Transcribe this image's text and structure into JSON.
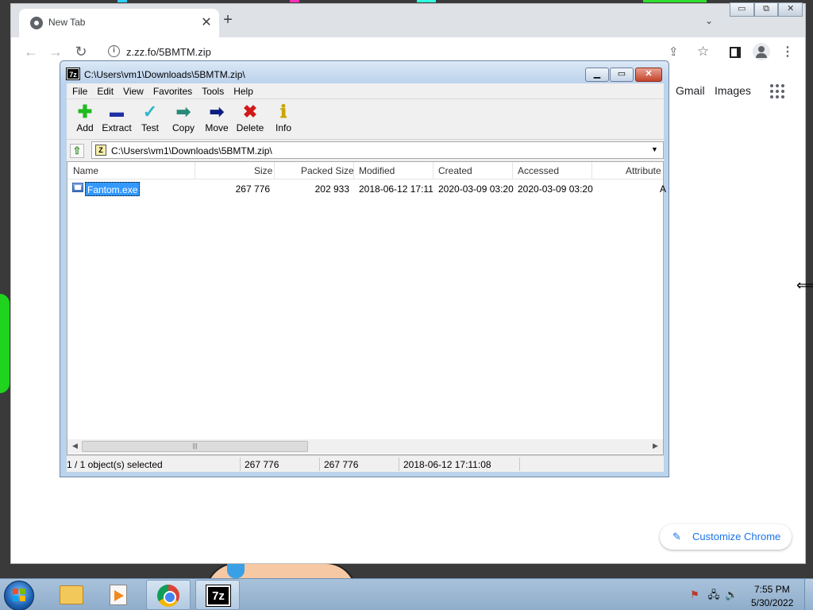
{
  "chrome": {
    "tab_title": "New Tab",
    "tab_close_glyph": "✕",
    "new_tab_glyph": "+",
    "tab_search_glyph": "⌄",
    "url": "z.zz.fo/5BMTM.zip",
    "ntp_links": [
      "Gmail",
      "Images"
    ],
    "customize_label": "Customize Chrome",
    "icons": {
      "back": "←",
      "forward": "→",
      "reload": "↻",
      "info": "i",
      "share": "⇪",
      "star": "☆",
      "menu": "⋮",
      "pencil": "✎"
    }
  },
  "outer_window_buttons": {
    "minimize": "▭",
    "restore": "⧉",
    "close": "✕"
  },
  "sevenzip": {
    "title": "C:\\Users\\vm1\\Downloads\\5BMTM.zip\\",
    "logo": "7z",
    "controls": {
      "minimize": "▁",
      "maximize": "▭",
      "close": "✕"
    },
    "menu": [
      "File",
      "Edit",
      "View",
      "Favorites",
      "Tools",
      "Help"
    ],
    "toolbar": [
      {
        "label": "Add",
        "glyph": "✚",
        "color": "#1dbb1d"
      },
      {
        "label": "Extract",
        "glyph": "▬",
        "color": "#1f2fa3"
      },
      {
        "label": "Test",
        "glyph": "✓",
        "color": "#2cb7c9"
      },
      {
        "label": "Copy",
        "glyph": "➡",
        "color": "#2a8a7a"
      },
      {
        "label": "Move",
        "glyph": "➡",
        "color": "#0b1f80"
      },
      {
        "label": "Delete",
        "glyph": "✖",
        "color": "#d11919"
      },
      {
        "label": "Info",
        "glyph": "ℹ",
        "color": "#c9a600"
      }
    ],
    "address": {
      "up_glyph": "⇧",
      "path": "C:\\Users\\vm1\\Downloads\\5BMTM.zip\\",
      "zip_icon": "Z",
      "drop_glyph": "▼"
    },
    "columns": [
      "Name",
      "Size",
      "Packed Size",
      "Modified",
      "Created",
      "Accessed",
      "Attribute"
    ],
    "rows": [
      {
        "name": "Fantom.exe",
        "size": "267 776",
        "packed": "202 933",
        "modified": "2018-06-12 17:11",
        "created": "2020-03-09 03:20",
        "accessed": "2020-03-09 03:20",
        "attributes": "A"
      }
    ],
    "scroll": {
      "left": "◀",
      "right": "▶",
      "thumb": "|||"
    },
    "status": {
      "selected": "1 / 1 object(s) selected",
      "size": "267 776",
      "packed": "267 776",
      "modified": "2018-06-12 17:11:08"
    }
  },
  "taskbar": {
    "sz_icon": "7z",
    "tray": {
      "flag": "⚑",
      "network": "🖧",
      "volume": "🔊"
    },
    "time": "7:55 PM",
    "date": "5/30/2022"
  },
  "cursor_glyph": "⟺"
}
